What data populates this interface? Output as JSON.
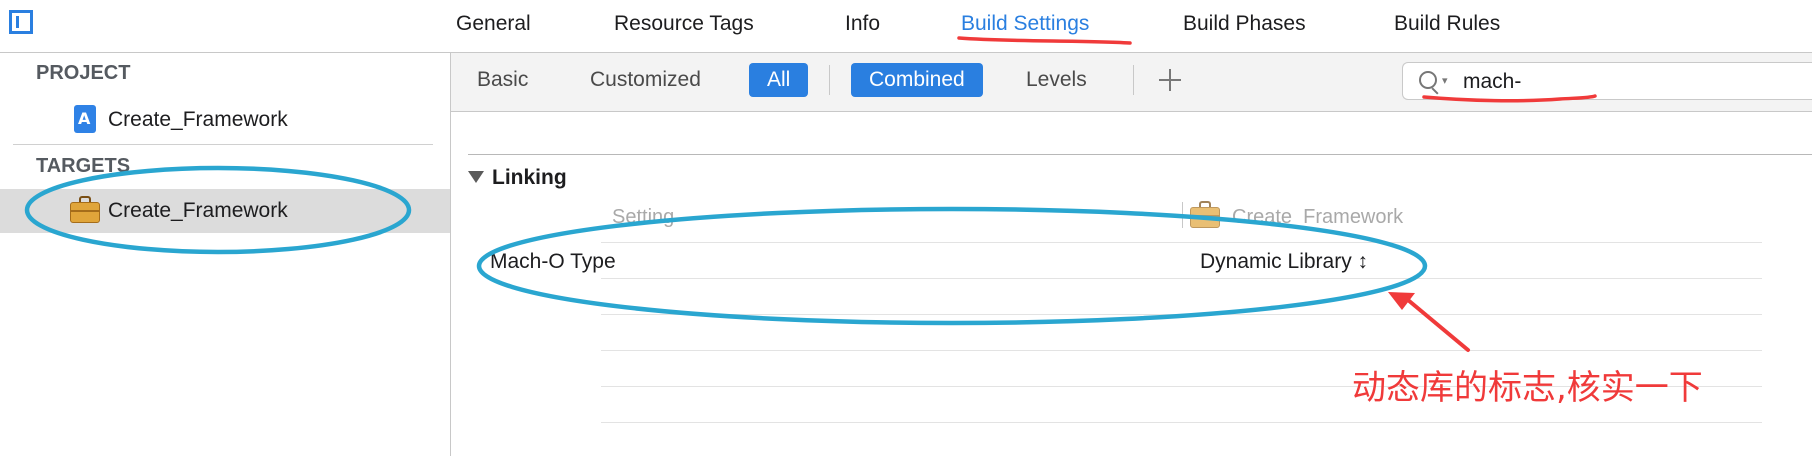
{
  "top_tabs": [
    "General",
    "Resource Tags",
    "Info",
    "Build Settings",
    "Build Phases",
    "Build Rules"
  ],
  "sidebar": {
    "project_header": "PROJECT",
    "project_item": "Create_Framework",
    "targets_header": "TARGETS",
    "target_item": "Create_Framework"
  },
  "filters": {
    "basic": "Basic",
    "customized": "Customized",
    "all": "All",
    "combined": "Combined",
    "levels": "Levels"
  },
  "search": {
    "value": "mach-"
  },
  "settings": {
    "section": "Linking",
    "column_setting": "Setting",
    "column_target": "Create_Framework",
    "rows": [
      {
        "name": "Mach-O Type",
        "value": "Dynamic Library ↕"
      }
    ]
  },
  "annotation": {
    "text": "动态库的标志,核实一下",
    "color": "#f03a3a",
    "highlight_color": "#2aa6d0"
  }
}
